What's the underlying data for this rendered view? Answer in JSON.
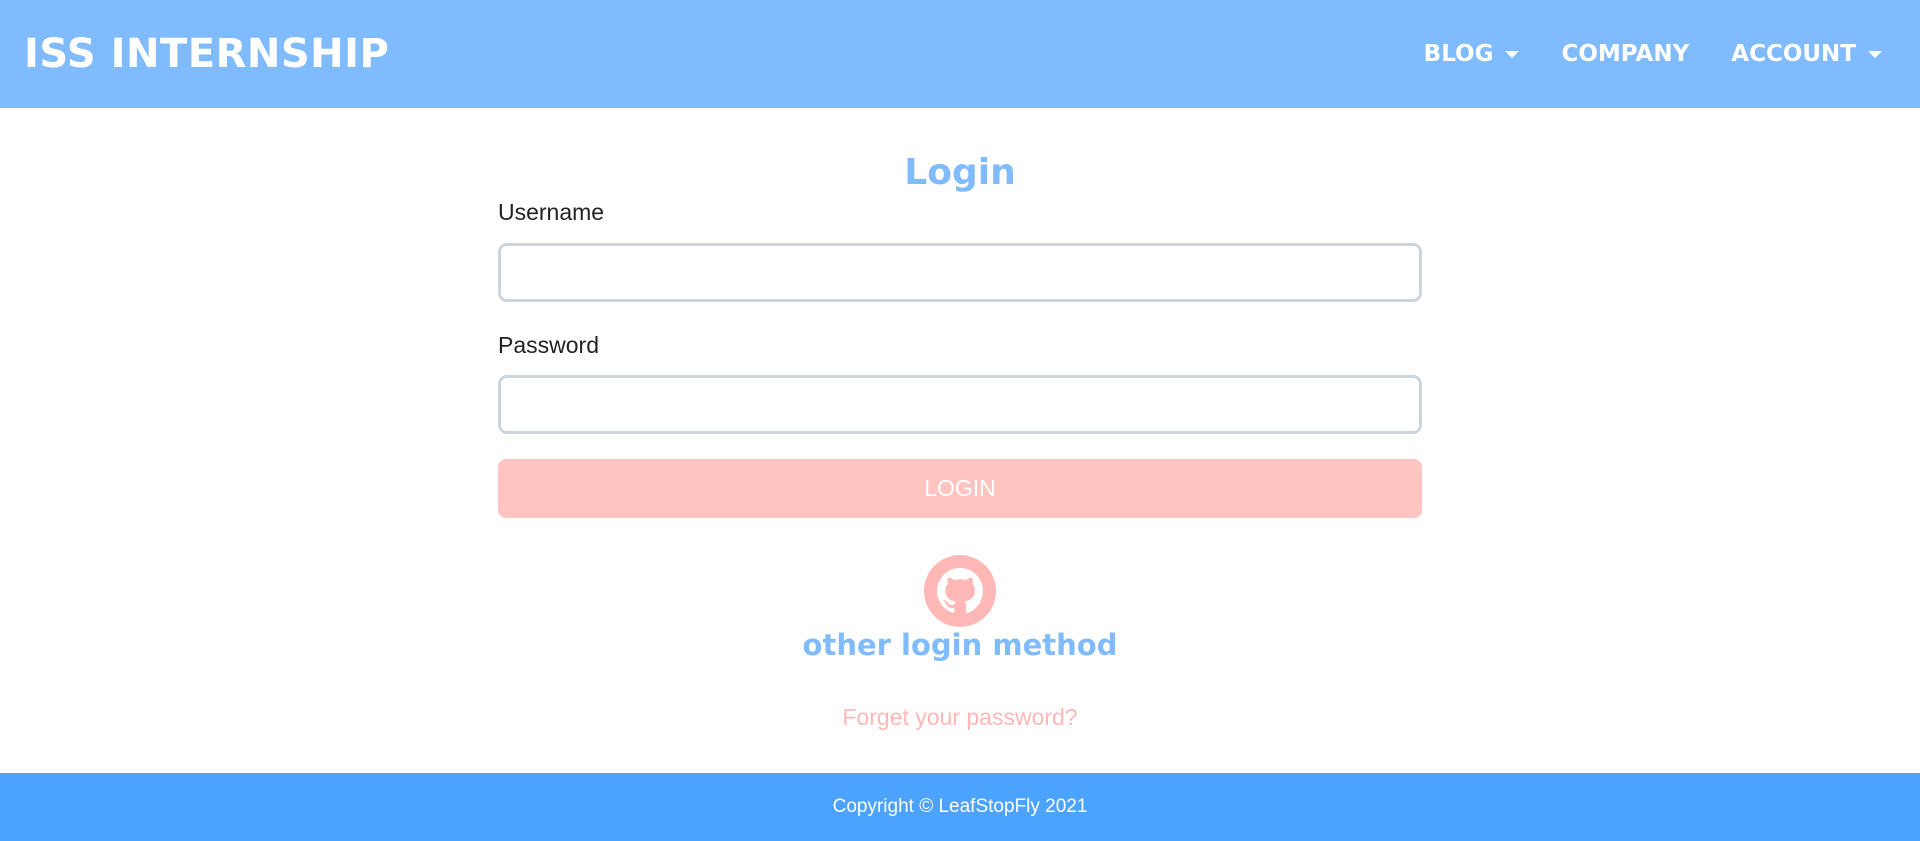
{
  "navbar": {
    "brand": "ISS INTERNSHIP",
    "links": [
      {
        "label": "BLOG",
        "dropdown": true
      },
      {
        "label": "COMPANY",
        "dropdown": false
      },
      {
        "label": "ACCOUNT",
        "dropdown": true
      }
    ]
  },
  "login": {
    "title": "Login",
    "username_label": "Username",
    "username_value": "",
    "password_label": "Password",
    "password_value": "",
    "submit_label": "LOGIN",
    "other_method_icon": "github-icon",
    "other_method_label": "other login method",
    "forget_label": "Forget your password?"
  },
  "footer": {
    "copyright": "Copyright © LeafStopFly 2021"
  },
  "colors": {
    "navbar_bg": "#80bbfd",
    "footer_bg": "#4ca3fd",
    "accent_blue": "#80bbfd",
    "button_pink": "#ffc3c0",
    "link_pink": "#ffb8b6"
  }
}
